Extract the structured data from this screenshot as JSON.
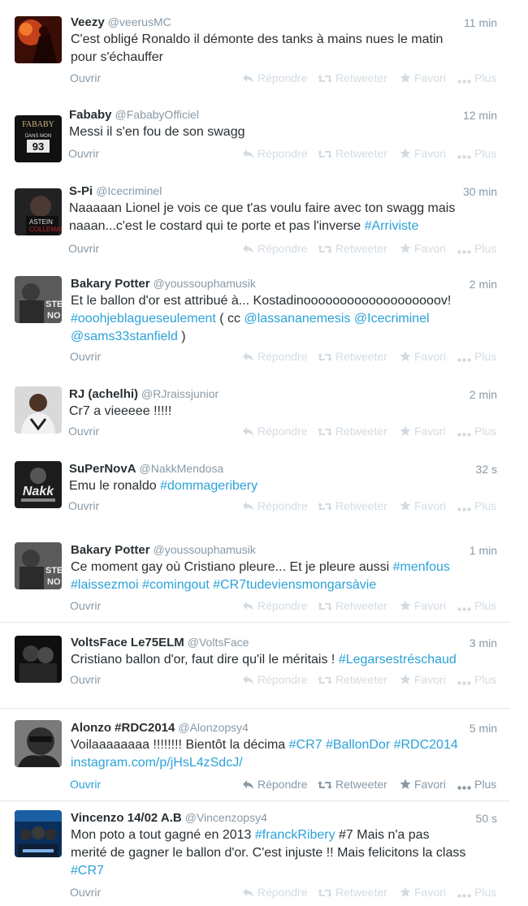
{
  "labels": {
    "open": "Ouvrir",
    "reply": "Répondre",
    "retweet": "Retweeter",
    "favorite": "Favori",
    "more": "Plus"
  },
  "colors": {
    "link": "#2ba2d8",
    "muted": "#8899a6",
    "faded_action": "#d3dbe2",
    "divider": "#e1e8ed"
  },
  "tweets": [
    {
      "name": "Veezy",
      "handle": "@veerusMC",
      "time": "11 min",
      "avatar": "avatar-veezy",
      "lines": [
        [
          {
            "t": "C'est obligé Ronaldo il démonte des tanks à mains nues le matin"
          }
        ],
        [
          {
            "t": "pour s'échauffer"
          }
        ]
      ]
    },
    {
      "name": "Fababy",
      "handle": "@FababyOfficiel",
      "time": "12 min",
      "avatar": "avatar-fababy",
      "lines": [
        [
          {
            "t": "Messi il s'en fou de son swagg"
          }
        ]
      ]
    },
    {
      "name": "S-Pi",
      "handle": "@Icecriminel",
      "time": "30 min",
      "avatar": "avatar-spi",
      "lines": [
        [
          {
            "t": "Naaaaan Lionel je vois ce que t'as voulu faire avec ton swagg mais"
          }
        ],
        [
          {
            "t": "naaan...c'est le costard qui te porte et pas l'inverse "
          },
          {
            "t": "#Arriviste",
            "k": "hashtag"
          }
        ]
      ]
    },
    {
      "name": "Bakary Potter",
      "handle": "@youssouphamusik",
      "time": "2 min",
      "avatar": "avatar-bakary",
      "lines": [
        [
          {
            "t": "Et le ballon d'or est attribué à... Kostadinooooooooooooooooooov!"
          }
        ],
        [
          {
            "t": "#ooohjeblagueseulement",
            "k": "hashtag"
          },
          {
            "t": " ( cc "
          },
          {
            "t": "@lassananemesis",
            "k": "mention"
          },
          {
            "t": " "
          },
          {
            "t": "@Icecriminel",
            "k": "mention"
          }
        ],
        [
          {
            "t": "@sams33stanfield",
            "k": "mention"
          },
          {
            "t": " )"
          }
        ]
      ]
    },
    {
      "name": "RJ (achelhi)",
      "handle": "@RJraissjunior",
      "time": "2 min",
      "avatar": "avatar-rj",
      "lines": [
        [
          {
            "t": "Cr7 a vieeeee !!!!!"
          }
        ]
      ]
    },
    {
      "name": "SuPerNovA",
      "handle": "@NakkMendosa",
      "time": "32 s",
      "avatar": "avatar-supernova",
      "lines": [
        [
          {
            "t": "Emu le ronaldo "
          },
          {
            "t": "#dommageribery",
            "k": "hashtag"
          }
        ]
      ]
    },
    {
      "name": "Bakary Potter",
      "handle": "@youssouphamusik",
      "time": "1 min",
      "avatar": "avatar-bakary",
      "lines": [
        [
          {
            "t": "Ce moment gay où Cristiano pleure... Et je pleure aussi "
          },
          {
            "t": "#menfous",
            "k": "hashtag"
          }
        ],
        [
          {
            "t": "#laissezmoi",
            "k": "hashtag"
          },
          {
            "t": " "
          },
          {
            "t": "#comingout",
            "k": "hashtag"
          },
          {
            "t": " "
          },
          {
            "t": "#CR7tudeviensmongarsàvie",
            "k": "hashtag"
          }
        ]
      ]
    },
    {
      "name": "VoltsFace Le75ELM",
      "handle": "@VoltsFace",
      "time": "3 min",
      "avatar": "avatar-voltsface",
      "lines": [
        [
          {
            "t": "Cristiano ballon d'or, faut dire qu'il le méritais ! "
          },
          {
            "t": "#Legarsestréschaud",
            "k": "hashtag"
          }
        ]
      ]
    },
    {
      "name": "Alonzo #RDC2014",
      "handle": "@Alonzopsy4",
      "time": "5 min",
      "avatar": "avatar-alonzo",
      "lines": [
        [
          {
            "t": "Voilaaaaaaaa !!!!!!!! Bientôt la décima "
          },
          {
            "t": "#CR7",
            "k": "hashtag"
          },
          {
            "t": " "
          },
          {
            "t": "#BallonDor",
            "k": "hashtag"
          },
          {
            "t": " "
          },
          {
            "t": "#RDC2014",
            "k": "hashtag"
          }
        ],
        [
          {
            "t": "instagram.com/p/jHsL4zSdcJ/",
            "k": "link"
          }
        ]
      ]
    },
    {
      "name": "Vincenzo 14/02 A.B",
      "handle": "@Vincenzopsy4",
      "time": "50 s",
      "avatar": "avatar-vincenzo",
      "lines": [
        [
          {
            "t": "Mon poto a tout gagné en 2013 "
          },
          {
            "t": "#franckRibery",
            "k": "hashtag"
          },
          {
            "t": " #7  Mais n'a pas"
          }
        ],
        [
          {
            "t": "merité de gagner le ballon d'or. C'est injuste !! Mais felicitons la class"
          }
        ],
        [
          {
            "t": "#CR7",
            "k": "hashtag"
          }
        ]
      ]
    }
  ]
}
